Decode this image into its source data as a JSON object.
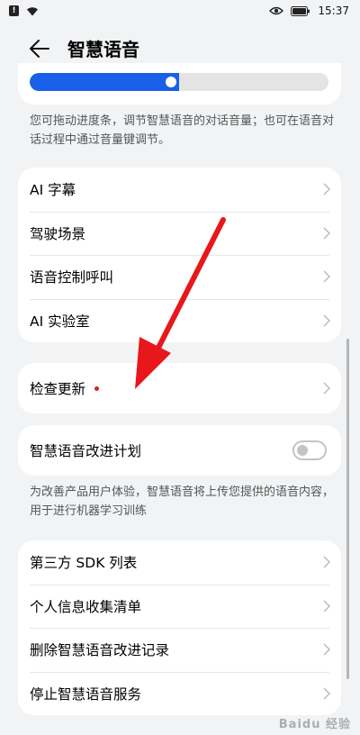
{
  "status_bar": {
    "time": "15:37"
  },
  "header": {
    "title": "智慧语音"
  },
  "volume": {
    "level": 0.5
  },
  "volume_note": "您可拖动进度条，调节智慧语音的对话音量；也可在语音对话过程中通过音量键调节。",
  "group1": [
    "AI 字幕",
    "驾驶场景",
    "语音控制呼叫",
    "AI 实验室"
  ],
  "check_update": "检查更新",
  "improve_plan": {
    "label": "智慧语音改进计划",
    "enabled": false
  },
  "improve_note": "为改善产品用户体验，智慧语音将上传您提供的语音内容，用于进行机器学习训练",
  "group2": [
    "第三方 SDK 列表",
    "个人信息收集清单",
    "删除智慧语音改进记录",
    "停止智慧语音服务"
  ],
  "watermark": "Baidu 经验",
  "colors": {
    "accent": "#1a5fe8",
    "arrow": "#e8171b",
    "badge": "#e02020"
  }
}
